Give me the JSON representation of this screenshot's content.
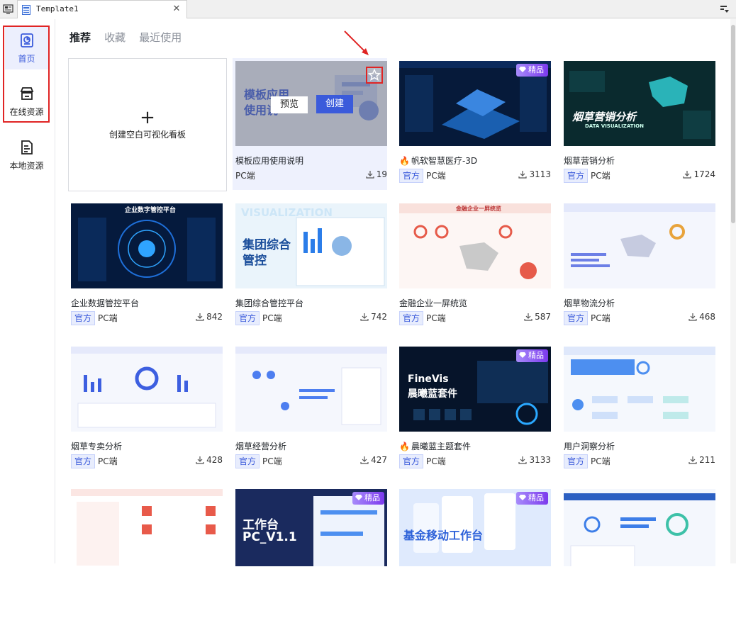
{
  "window": {
    "tab_title": "Template1",
    "close_glyph": "✕"
  },
  "sidebar": {
    "items": [
      {
        "label": "首页",
        "icon": "home-chart-icon"
      },
      {
        "label": "在线资源",
        "icon": "store-icon"
      },
      {
        "label": "本地资源",
        "icon": "file-icon"
      }
    ]
  },
  "filter_tabs": [
    "推荐",
    "收藏",
    "最近使用"
  ],
  "blank_card": {
    "plus": "+",
    "label": "创建空白可视化看板"
  },
  "hover_actions": {
    "preview": "预览",
    "create": "创建"
  },
  "premium_label": "精品",
  "official_label": "官方",
  "thumb_texts": {
    "t1a": "模板应用",
    "t1b": "使用说",
    "t4": "烟草营销分析",
    "t4sub": "DATA VISUALIZATION",
    "t5": "企业数字管控平台",
    "t6a": "集团综合",
    "t6b": "管控",
    "t6c": "VISUALIZATION",
    "t7": "金融企业一屏统览",
    "t11a": "FineVis",
    "t11b": "晨曦蓝套件",
    "t14a": "工作台",
    "t14b": "PC_V1.1",
    "t15": "基金移动工作台"
  },
  "cards": [
    {
      "title": "模板应用使用说明",
      "platform": "PC端",
      "downloads": "19",
      "fire": false,
      "official": false,
      "premium": false
    },
    {
      "title": "帆软智慧医疗-3D",
      "platform": "PC端",
      "downloads": "3113",
      "fire": true,
      "official": true,
      "premium": true
    },
    {
      "title": "烟草营销分析",
      "platform": "PC端",
      "downloads": "1724",
      "fire": false,
      "official": true,
      "premium": false
    },
    {
      "title": "企业数据管控平台",
      "platform": "PC端",
      "downloads": "842",
      "fire": false,
      "official": true,
      "premium": false
    },
    {
      "title": "集团综合管控平台",
      "platform": "PC端",
      "downloads": "742",
      "fire": false,
      "official": true,
      "premium": false
    },
    {
      "title": "金融企业一屏统览",
      "platform": "PC端",
      "downloads": "587",
      "fire": false,
      "official": true,
      "premium": false
    },
    {
      "title": "烟草物流分析",
      "platform": "PC端",
      "downloads": "468",
      "fire": false,
      "official": true,
      "premium": false
    },
    {
      "title": "烟草专卖分析",
      "platform": "PC端",
      "downloads": "428",
      "fire": false,
      "official": true,
      "premium": false
    },
    {
      "title": "烟草经营分析",
      "platform": "PC端",
      "downloads": "427",
      "fire": false,
      "official": true,
      "premium": false
    },
    {
      "title": "晨曦蓝主题套件",
      "platform": "PC端",
      "downloads": "3133",
      "fire": true,
      "official": true,
      "premium": true
    },
    {
      "title": "用户洞察分析",
      "platform": "PC端",
      "downloads": "211",
      "fire": false,
      "official": true,
      "premium": false
    }
  ],
  "colors": {
    "accent": "#3b5bdb",
    "highlight": "#e02424",
    "premium": "#7c3aed"
  }
}
